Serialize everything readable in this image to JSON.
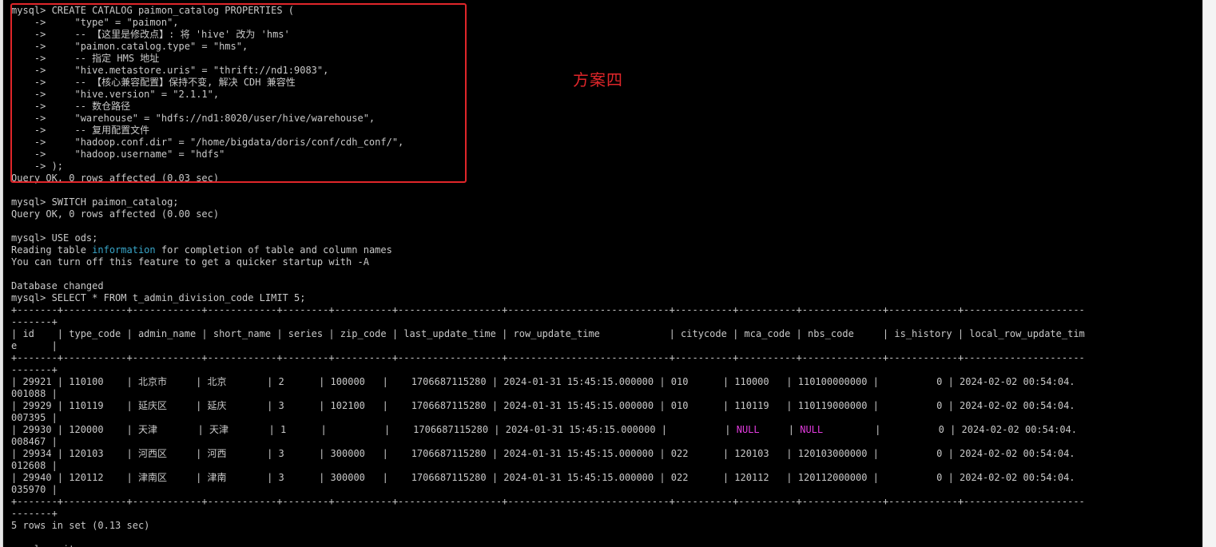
{
  "annotation": {
    "label": "方案四"
  },
  "colors": {
    "highlight": "#e0262a",
    "null_value": "#e23bde",
    "keyword": "#39a6c9",
    "text": "#c9c9c9",
    "background": "#000000"
  },
  "terminal": {
    "lines": [
      "mysql> CREATE CATALOG paimon_catalog PROPERTIES (",
      "    ->     \"type\" = \"paimon\",",
      "    ->     -- 【这里是修改点】: 将 'hive' 改为 'hms'",
      "    ->     \"paimon.catalog.type\" = \"hms\",",
      "    ->     -- 指定 HMS 地址",
      "    ->     \"hive.metastore.uris\" = \"thrift://nd1:9083\",",
      "    ->     -- 【核心兼容配置】保持不变, 解决 CDH 兼容性",
      "    ->     \"hive.version\" = \"2.1.1\",",
      "    ->     -- 数仓路径",
      "    ->     \"warehouse\" = \"hdfs://nd1:8020/user/hive/warehouse\",",
      "    ->     -- 复用配置文件",
      "    ->     \"hadoop.conf.dir\" = \"/home/bigdata/doris/conf/cdh_conf/\",",
      "    ->     \"hadoop.username\" = \"hdfs\"",
      "    -> );",
      "Query OK, 0 rows affected (0.03 sec)",
      "",
      "mysql> SWITCH paimon_catalog;",
      "Query OK, 0 rows affected (0.00 sec)",
      "",
      "mysql> USE ods;",
      {
        "parts": [
          "Reading table ",
          {
            "t": "information",
            "c": "cyan"
          },
          " for completion of table and column names"
        ]
      },
      "You can turn off this feature to get a quicker startup with -A",
      "",
      "Database changed",
      "mysql> SELECT * FROM t_admin_division_code LIMIT 5;",
      "+-------+-----------+------------+------------+--------+----------+------------------+----------------------------+----------+----------+--------------+------------+---------------------",
      "-------+",
      "| id    | type_code | admin_name | short_name | series | zip_code | last_update_time | row_update_time            | citycode | mca_code | nbs_code     | is_history | local_row_update_tim",
      "e      |",
      "+-------+-----------+------------+------------+--------+----------+------------------+----------------------------+----------+----------+--------------+------------+---------------------",
      "-------+",
      "| 29921 | 110100    | 北京市     | 北京       | 2      | 100000   |    1706687115280 | 2024-01-31 15:45:15.000000 | 010      | 110000   | 110100000000 |          0 | 2024-02-02 00:54:04.",
      "001088 |",
      "| 29929 | 110119    | 延庆区     | 延庆       | 3      | 102100   |    1706687115280 | 2024-01-31 15:45:15.000000 | 010      | 110119   | 110119000000 |          0 | 2024-02-02 00:54:04.",
      "007395 |",
      {
        "parts": [
          "| 29930 | 120000    | 天津       | 天津       | 1      |          |    1706687115280 | 2024-01-31 15:45:15.000000 |          | ",
          {
            "t": "NULL",
            "c": "magenta"
          },
          "     | ",
          {
            "t": "NULL",
            "c": "magenta"
          },
          "         |          0 | 2024-02-02 00:54:04."
        ]
      },
      "008467 |",
      "| 29934 | 120103    | 河西区     | 河西       | 3      | 300000   |    1706687115280 | 2024-01-31 15:45:15.000000 | 022      | 120103   | 120103000000 |          0 | 2024-02-02 00:54:04.",
      "012608 |",
      "| 29940 | 120112    | 津南区     | 津南       | 3      | 300000   |    1706687115280 | 2024-01-31 15:45:15.000000 | 022      | 120112   | 120112000000 |          0 | 2024-02-02 00:54:04.",
      "035970 |",
      "+-------+-----------+------------+------------+--------+----------+------------------+----------------------------+----------+----------+--------------+------------+---------------------",
      "-------+",
      "5 rows in set (0.13 sec)",
      "",
      "mysql> exit"
    ]
  }
}
